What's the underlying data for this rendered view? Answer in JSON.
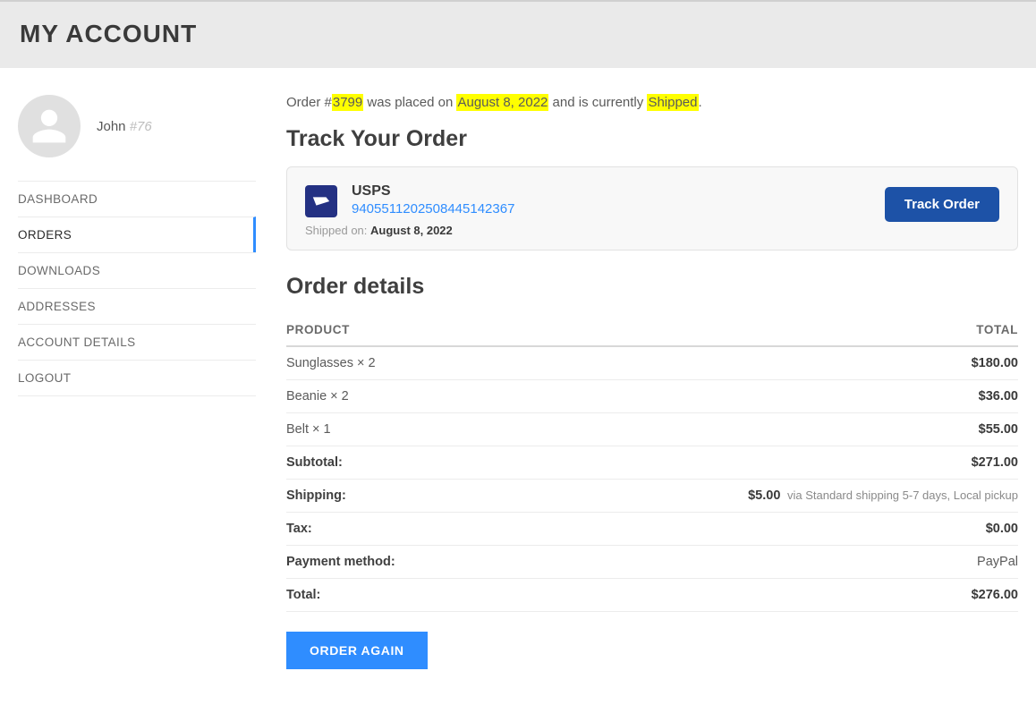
{
  "header": {
    "title": "MY ACCOUNT"
  },
  "profile": {
    "name": "John",
    "id": "#76"
  },
  "nav": {
    "items": [
      {
        "label": "DASHBOARD",
        "active": false
      },
      {
        "label": "ORDERS",
        "active": true
      },
      {
        "label": "DOWNLOADS",
        "active": false
      },
      {
        "label": "ADDRESSES",
        "active": false
      },
      {
        "label": "ACCOUNT DETAILS",
        "active": false
      },
      {
        "label": "LOGOUT",
        "active": false
      }
    ]
  },
  "order": {
    "summary_prefix": "Order #",
    "number": "3799",
    "summary_mid1": " was placed on ",
    "date": "August 8, 2022",
    "summary_mid2": " and is currently ",
    "status": "Shipped",
    "summary_suffix": ".",
    "track_heading": "Track Your Order",
    "carrier": "USPS",
    "tracking_number": "9405511202508445142367",
    "shipped_on_label": "Shipped on: ",
    "shipped_on_date": "August 8, 2022",
    "track_button": "Track Order",
    "details_heading": "Order details",
    "columns": {
      "product": "PRODUCT",
      "total": "TOTAL"
    },
    "line_items": [
      {
        "product": "Sunglasses × 2",
        "total": "$180.00"
      },
      {
        "product": "Beanie × 2",
        "total": "$36.00"
      },
      {
        "product": "Belt × 1",
        "total": "$55.00"
      }
    ],
    "totals": [
      {
        "label": "Subtotal:",
        "value": "$271.00",
        "note": ""
      },
      {
        "label": "Shipping:",
        "value": "$5.00",
        "note": " via Standard shipping 5-7 days, Local pickup"
      },
      {
        "label": "Tax:",
        "value": "$0.00",
        "note": ""
      },
      {
        "label": "Payment method:",
        "value": "PayPal",
        "note": "",
        "plain": true
      },
      {
        "label": "Total:",
        "value": "$276.00",
        "note": ""
      }
    ],
    "order_again": "ORDER AGAIN"
  }
}
